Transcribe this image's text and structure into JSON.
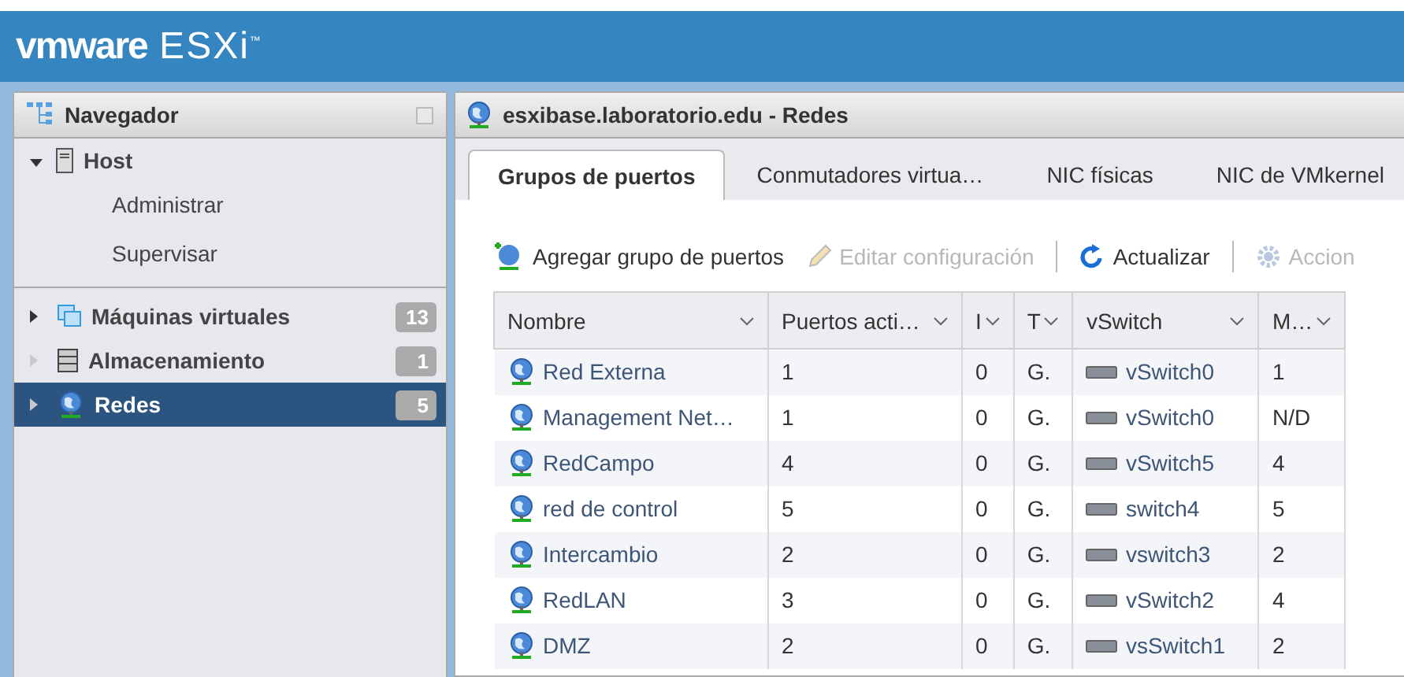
{
  "header": {
    "brand": "vmware",
    "product": "ESXi",
    "trademark": "™"
  },
  "navigator": {
    "title": "Navegador",
    "items": [
      {
        "label": "Host",
        "kind": "host",
        "expanded": true,
        "selected": false,
        "children": [
          {
            "label": "Administrar",
            "selected": false
          },
          {
            "label": "Supervisar",
            "selected": false
          }
        ]
      },
      {
        "label": "Máquinas virtuales",
        "kind": "vms",
        "expanded": false,
        "selected": false,
        "count": "13"
      },
      {
        "label": "Almacenamiento",
        "kind": "storage",
        "expanded": false,
        "selected": false,
        "count": "1"
      },
      {
        "label": "Redes",
        "kind": "network",
        "expanded": false,
        "selected": true,
        "count": "5"
      }
    ]
  },
  "content": {
    "title": "esxibase.laboratorio.edu - Redes",
    "tabs": [
      {
        "label": "Grupos de puertos",
        "selected": true
      },
      {
        "label": "Conmutadores virtua…",
        "selected": false
      },
      {
        "label": "NIC físicas",
        "selected": false
      },
      {
        "label": "NIC de VMkernel",
        "selected": false
      }
    ],
    "toolbar": [
      {
        "label": "Agregar grupo de puertos",
        "kind": "add",
        "disabled": false
      },
      {
        "label": "Editar configuración",
        "kind": "edit",
        "disabled": true
      },
      {
        "label": "Actualizar",
        "kind": "refresh",
        "disabled": false
      },
      {
        "label": "Accion",
        "kind": "actions",
        "disabled": true
      }
    ],
    "table": {
      "columns": [
        "Nombre",
        "Puertos acti…",
        "I",
        "T",
        "vSwitch",
        "M…"
      ],
      "rows": [
        [
          "Red Externa",
          "1",
          "0",
          "G.",
          "vSwitch0",
          "1"
        ],
        [
          "Management Net…",
          "1",
          "0",
          "G.",
          "vSwitch0",
          "N/D"
        ],
        [
          "RedCampo",
          "4",
          "0",
          "G.",
          "vSwitch5",
          "4"
        ],
        [
          "red de control",
          "5",
          "0",
          "G.",
          "switch4",
          "5"
        ],
        [
          "Intercambio",
          "2",
          "0",
          "G.",
          "vswitch3",
          "2"
        ],
        [
          "RedLAN",
          "3",
          "0",
          "G.",
          "vSwitch2",
          "4"
        ],
        [
          "DMZ",
          "2",
          "0",
          "G.",
          "vsSwitch1",
          "2"
        ]
      ]
    }
  }
}
